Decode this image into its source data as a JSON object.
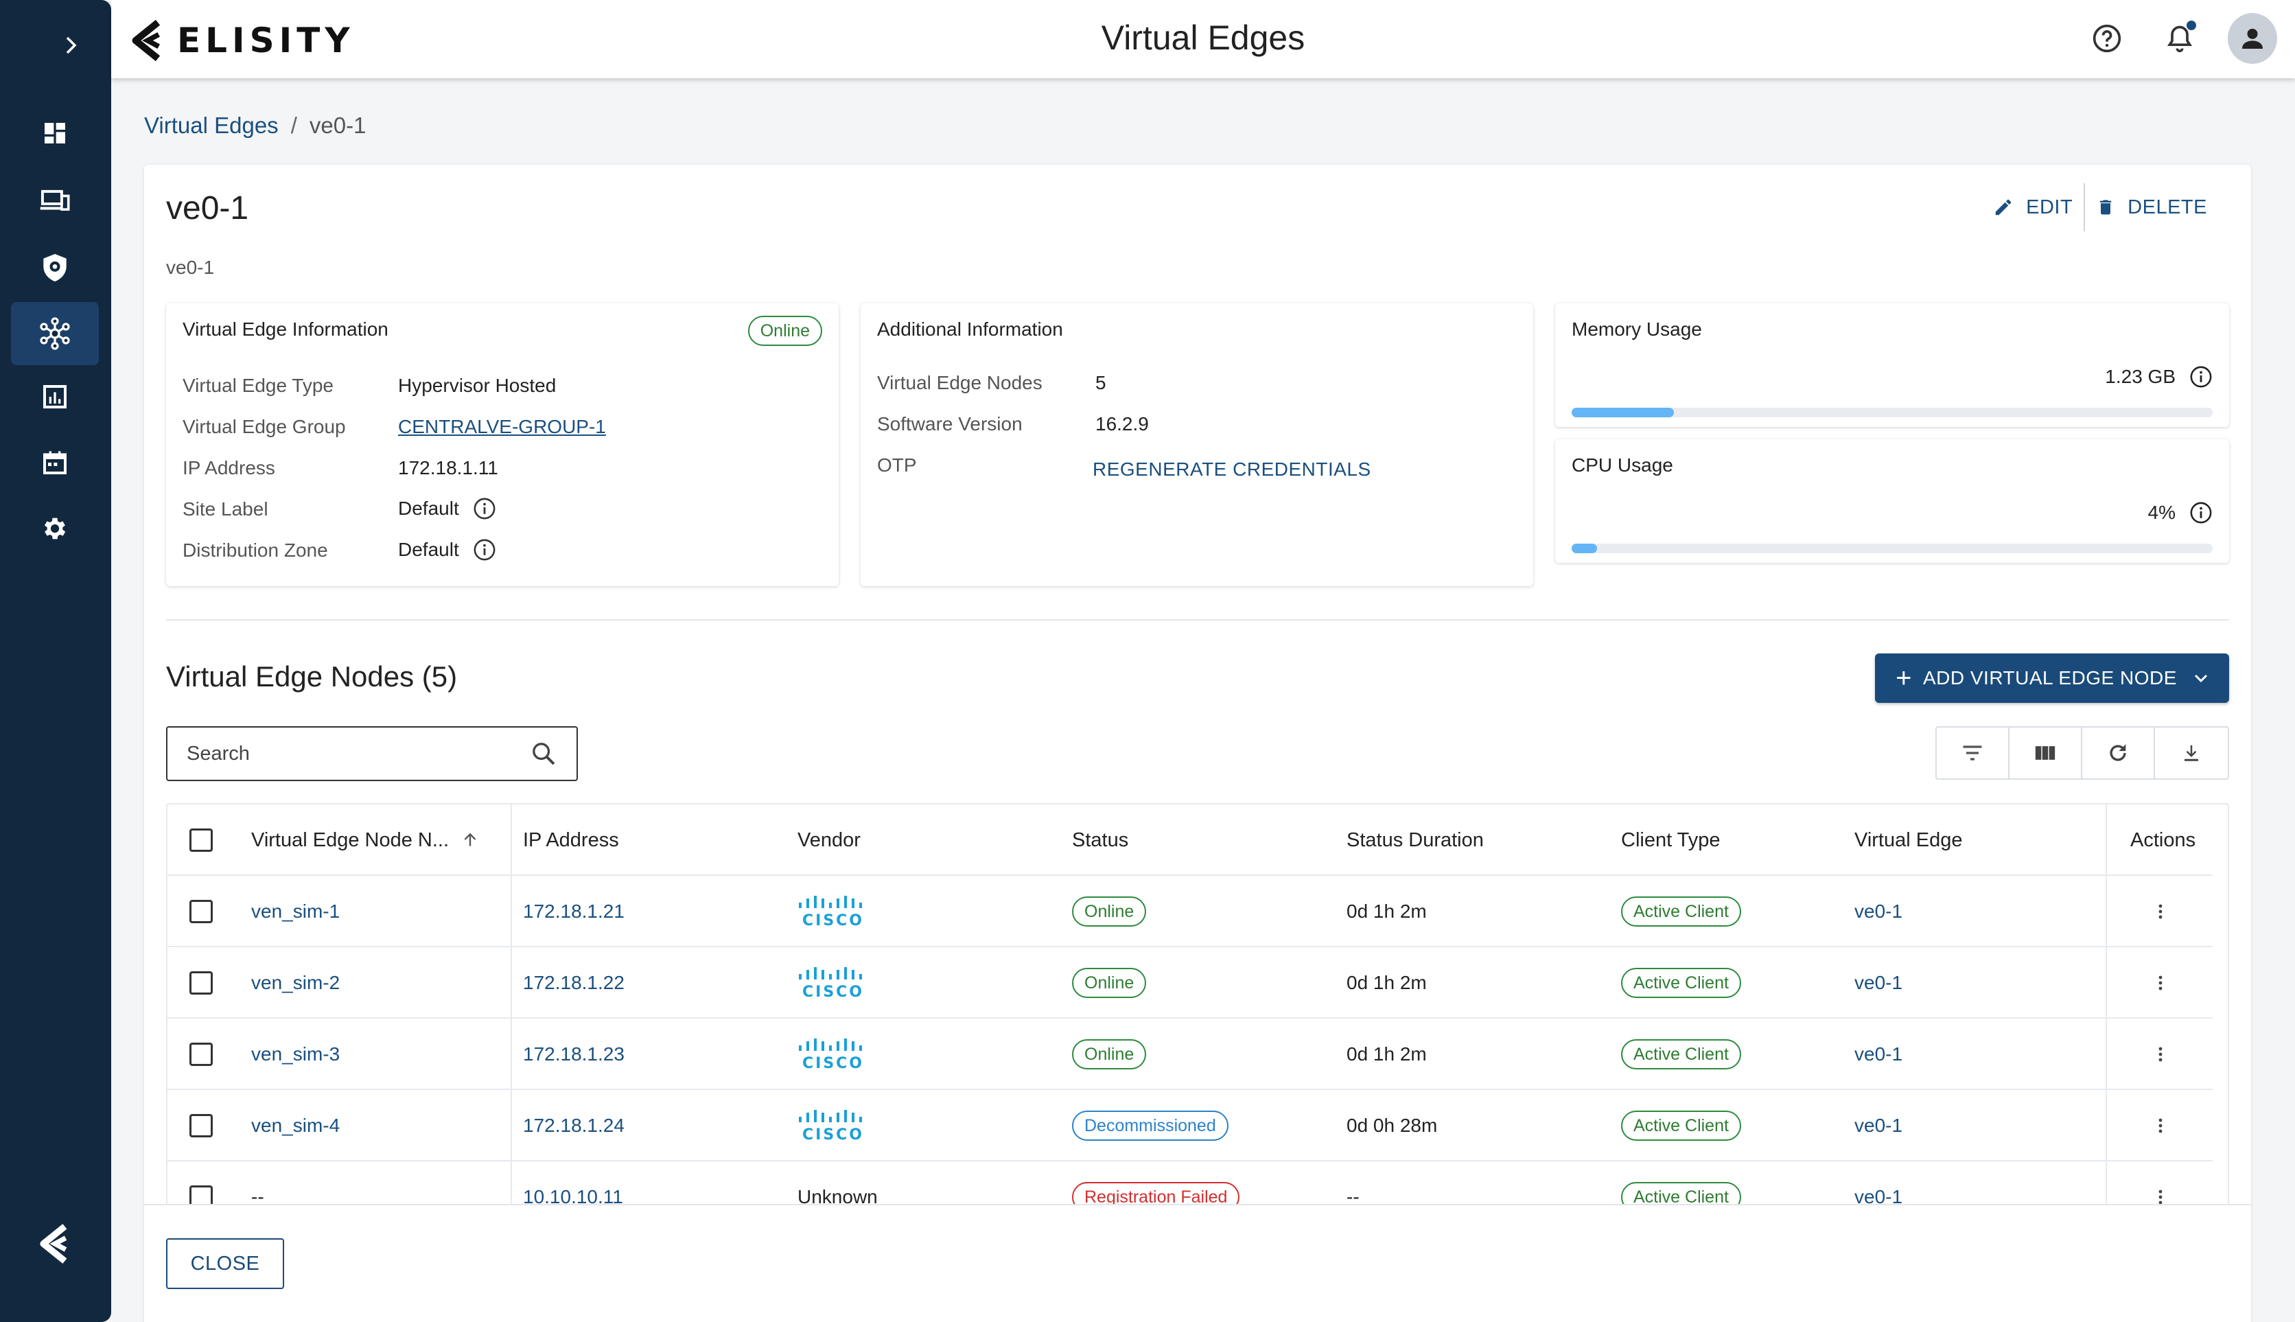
{
  "app": {
    "brand": "ELISITY",
    "title": "Virtual Edges"
  },
  "sidebar": {
    "items": [
      {
        "icon": "dashboard-icon"
      },
      {
        "icon": "devices-icon"
      },
      {
        "icon": "shield-icon"
      },
      {
        "icon": "network-hub-icon",
        "active": true
      },
      {
        "icon": "analytics-icon"
      },
      {
        "icon": "calendar-icon"
      },
      {
        "icon": "gear-icon"
      }
    ]
  },
  "breadcrumb": {
    "parent": "Virtual Edges",
    "separator": "/",
    "current": "ve0-1"
  },
  "header": {
    "name": "ve0-1",
    "description": "ve0-1",
    "edit_label": "EDIT",
    "delete_label": "DELETE"
  },
  "ve_info": {
    "title": "Virtual Edge Information",
    "status": "Online",
    "type_label": "Virtual Edge Type",
    "type_value": "Hypervisor Hosted",
    "group_label": "Virtual Edge Group",
    "group_value": "CENTRALVE-GROUP-1",
    "ip_label": "IP Address",
    "ip_value": "172.18.1.11",
    "site_label": "Site Label",
    "site_value": "Default",
    "zone_label": "Distribution Zone",
    "zone_value": "Default"
  },
  "additional": {
    "title": "Additional Information",
    "nodes_label": "Virtual Edge Nodes",
    "nodes_value": "5",
    "version_label": "Software Version",
    "version_value": "16.2.9",
    "otp_label": "OTP",
    "otp_action": "REGENERATE CREDENTIALS"
  },
  "memory": {
    "title": "Memory Usage",
    "value": "1.23 GB",
    "fraction": 0.16
  },
  "cpu": {
    "title": "CPU Usage",
    "value": "4%",
    "fraction": 0.04
  },
  "nodes": {
    "title": "Virtual Edge Nodes (5)",
    "add_label": "ADD VIRTUAL EDGE NODE",
    "search_placeholder": "Search",
    "columns": {
      "name": "Virtual Edge Node N...",
      "ip": "IP Address",
      "vendor": "Vendor",
      "status": "Status",
      "duration": "Status Duration",
      "client": "Client Type",
      "edge": "Virtual Edge",
      "actions": "Actions"
    },
    "rows": [
      {
        "name": "ven_sim-1",
        "ip": "172.18.1.21",
        "vendor": "cisco",
        "status": "Online",
        "status_color": "#2e7d32",
        "duration": "0d 1h 2m",
        "client": "Active Client",
        "edge": "ve0-1"
      },
      {
        "name": "ven_sim-2",
        "ip": "172.18.1.22",
        "vendor": "cisco",
        "status": "Online",
        "status_color": "#2e7d32",
        "duration": "0d 1h 2m",
        "client": "Active Client",
        "edge": "ve0-1"
      },
      {
        "name": "ven_sim-3",
        "ip": "172.18.1.23",
        "vendor": "cisco",
        "status": "Online",
        "status_color": "#2e7d32",
        "duration": "0d 1h 2m",
        "client": "Active Client",
        "edge": "ve0-1"
      },
      {
        "name": "ven_sim-4",
        "ip": "172.18.1.24",
        "vendor": "cisco",
        "status": "Decommissioned",
        "status_color": "#2c82c9",
        "duration": "0d 0h 28m",
        "client": "Active Client",
        "edge": "ve0-1"
      },
      {
        "name": "--",
        "ip": "10.10.10.11",
        "vendor": "Unknown",
        "status": "Registration Failed",
        "status_color": "#d32f2f",
        "duration": "--",
        "client": "Active Client",
        "edge": "ve0-1"
      }
    ]
  },
  "footer": {
    "close_label": "CLOSE"
  },
  "colors": {
    "sidebar": "#12283f",
    "primary": "#1a4a7a",
    "online": "#2e7d32",
    "usage_bar": "#64b5f6"
  }
}
